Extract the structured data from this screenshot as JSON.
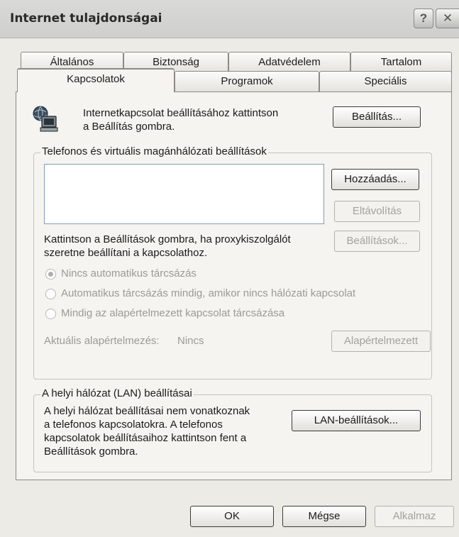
{
  "window": {
    "title": "Internet tulajdonságai",
    "help_glyph": "?",
    "close_glyph": "✕"
  },
  "tabs_back": [
    {
      "label": "Általános"
    },
    {
      "label": "Biztonság"
    },
    {
      "label": "Adatvédelem"
    },
    {
      "label": "Tartalom"
    }
  ],
  "tabs_front": [
    {
      "label": "Kapcsolatok",
      "selected": true
    },
    {
      "label": "Programok"
    },
    {
      "label": "Speciális"
    }
  ],
  "connection": {
    "icon": "network-computer-icon",
    "line1": "Internetkapcsolat beállításához kattintson",
    "line2": "a Beállítás gombra.",
    "setup_button": "Beállítás..."
  },
  "dialup": {
    "legend": "Telefonos és virtuális magánhálózati beállítások",
    "add_button": "Hozzáadás...",
    "remove_button": "Eltávolítás",
    "settings_button": "Beállítások...",
    "proxy_line1": "Kattintson a Beállítások gombra, ha proxykiszolgálót",
    "proxy_line2": "szeretne beállítani a kapcsolathoz.",
    "options": [
      {
        "label": "Nincs automatikus tárcsázás",
        "checked": true
      },
      {
        "label": "Automatikus tárcsázás mindig, amikor nincs hálózati kapcsolat",
        "checked": false
      },
      {
        "label": "Mindig az alapértelmezett kapcsolat tárcsázása",
        "checked": false
      }
    ],
    "current_default_label": "Aktuális alapértelmezés:",
    "current_default_value": "Nincs",
    "set_default_button": "Alapértelmezett"
  },
  "lan": {
    "legend": "A helyi hálózat (LAN) beállításai",
    "line1": "A helyi hálózat beállításai nem vonatkoznak",
    "line2": "a telefonos kapcsolatokra. A telefonos",
    "line3": "kapcsolatok beállításaihoz kattintson fent a",
    "line4": "Beállítások gombra.",
    "lan_button": "LAN-beállítások..."
  },
  "footer": {
    "ok": "OK",
    "cancel": "Mégse",
    "apply": "Alkalmaz"
  }
}
